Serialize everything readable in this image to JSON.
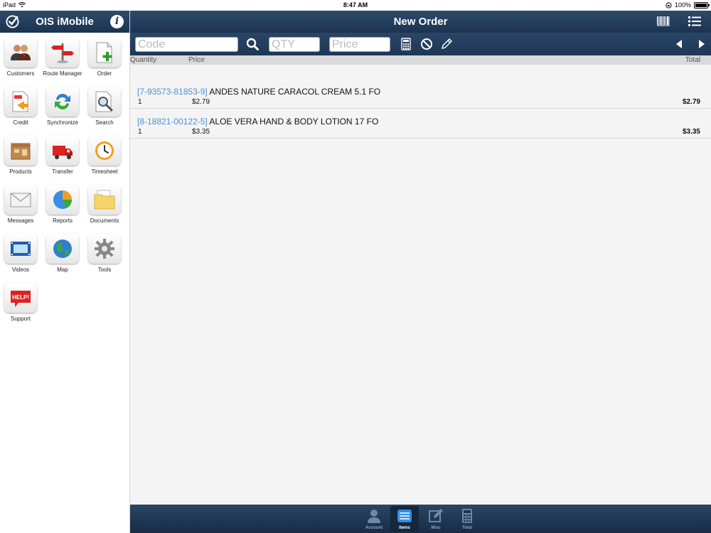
{
  "status_bar": {
    "device": "iPad",
    "time": "8:47 AM",
    "battery": "100%"
  },
  "sidebar": {
    "title": "OIS iMobile",
    "info_label": "i",
    "tiles": [
      {
        "label": "Customers",
        "icon": "customers-icon"
      },
      {
        "label": "Route Manager",
        "icon": "route-manager-icon"
      },
      {
        "label": "Order",
        "icon": "order-icon"
      },
      {
        "label": "Credit",
        "icon": "credit-icon"
      },
      {
        "label": "Synchronize",
        "icon": "synchronize-icon"
      },
      {
        "label": "Search",
        "icon": "search-icon"
      },
      {
        "label": "Products",
        "icon": "products-icon"
      },
      {
        "label": "Transfer",
        "icon": "transfer-icon"
      },
      {
        "label": "Timesheet",
        "icon": "timesheet-icon"
      },
      {
        "label": "Messages",
        "icon": "messages-icon"
      },
      {
        "label": "Reports",
        "icon": "reports-icon"
      },
      {
        "label": "Documents",
        "icon": "documents-icon"
      },
      {
        "label": "Videos",
        "icon": "videos-icon"
      },
      {
        "label": "Map",
        "icon": "map-icon"
      },
      {
        "label": "Tools",
        "icon": "tools-icon"
      },
      {
        "label": "Support",
        "icon": "support-icon",
        "badge": "HELP!"
      }
    ]
  },
  "main": {
    "title": "New Order",
    "toolbar": {
      "code_placeholder": "Code",
      "qty_placeholder": "QTY",
      "price_placeholder": "Price"
    },
    "columns": {
      "quantity": "Quantity",
      "price": "Price",
      "total": "Total"
    },
    "items": [
      {
        "code": "[7-93573-81853-9]",
        "name": "ANDES NATURE CARACOL CREAM 5.1 FO",
        "quantity": "1",
        "price": "$2.79",
        "total": "$2.79"
      },
      {
        "code": "[8-18821-00122-5]",
        "name": "ALOE VERA HAND & BODY LOTION 17 FO",
        "quantity": "1",
        "price": "$3.35",
        "total": "$3.35"
      }
    ]
  },
  "tabbar": {
    "tabs": [
      {
        "label": "Account",
        "icon": "account-icon",
        "active": false
      },
      {
        "label": "Items",
        "icon": "items-icon",
        "active": true
      },
      {
        "label": "Misc",
        "icon": "misc-edit-icon",
        "active": false
      },
      {
        "label": "Total",
        "icon": "calculator-icon",
        "active": false
      }
    ]
  },
  "colors": {
    "header_bg": "#1b3350",
    "accent_blue": "#4a90d9",
    "content_bg": "#f4f4f4"
  }
}
